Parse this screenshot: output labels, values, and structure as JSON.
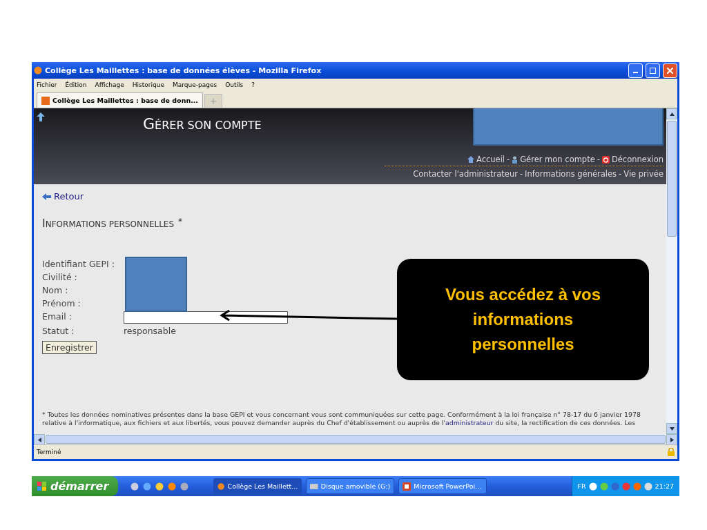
{
  "window": {
    "title": "Collège Les Maillettes : base de données élèves - Mozilla Firefox"
  },
  "menu": [
    "Fichier",
    "Édition",
    "Affichage",
    "Historique",
    "Marque-pages",
    "Outils",
    "?"
  ],
  "tabs": [
    {
      "label": "Collège Les Maillettes : base de donn...",
      "selected": true
    }
  ],
  "header": {
    "title": "GÉRER SON COMPTE",
    "nav": [
      {
        "label": "Accueil",
        "kind": "home",
        "separator": "-"
      },
      {
        "label": "Gérer mon compte",
        "kind": "user",
        "separator": "-"
      },
      {
        "label": "Déconnexion",
        "kind": "power"
      }
    ],
    "links": [
      {
        "label": "Contacter l'administrateur",
        "separator": "-"
      },
      {
        "label": "Informations générales",
        "separator": "-"
      },
      {
        "label": "Vie privée"
      }
    ]
  },
  "back_link": "Retour",
  "section_title": "INFORMATIONS PERSONNELLES",
  "section_mark": "*",
  "form": [
    {
      "label": "Identifiant GEPI :",
      "kind": "redacted"
    },
    {
      "label": "Civilité :",
      "kind": "redacted"
    },
    {
      "label": "Nom :",
      "kind": "redacted"
    },
    {
      "label": "Prénom :",
      "kind": "redacted"
    },
    {
      "label": "Email :",
      "kind": "input"
    },
    {
      "label": "Statut :",
      "kind": "text",
      "value": "responsable"
    }
  ],
  "save_button": "Enregistrer",
  "footnote": {
    "before": "* Toutes les données nominatives présentes dans la base GEPI et vous concernant vous sont communiquées sur cette page. Conformément à la loi française n° 78-17 du 6 janvier 1978 relative à l'informatique, aux fichiers et aux libertés, vous pouvez demander auprès du Chef d'établissement ou auprès de l'",
    "link": "administrateur",
    "after": " du site, la rectification de ces données. Les"
  },
  "status_bar": "Terminé",
  "callout": "Vous accédez à vos informations personnelles",
  "taskbar": {
    "start": "démarrer",
    "tasks": [
      {
        "label": "Collège Les Maillett...",
        "kind": "firefox",
        "selected": true
      },
      {
        "label": "Disque amovible (G:)",
        "kind": "drive",
        "selected": false
      },
      {
        "label": "Microsoft PowerPoi...",
        "kind": "powerpoint",
        "selected": false
      }
    ],
    "language": "FR",
    "clock": "21:27"
  }
}
